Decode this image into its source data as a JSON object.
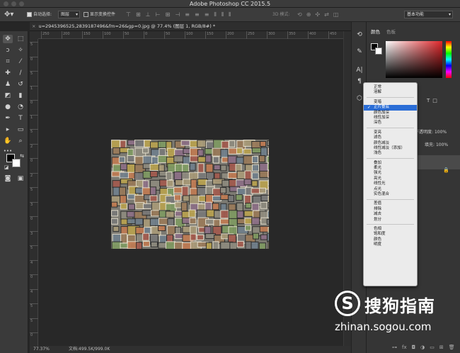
{
  "window": {
    "title": "Adobe Photoshop CC 2015.5"
  },
  "options_bar": {
    "auto_select_label": "自动选择:",
    "auto_select_value": "图层",
    "show_transform_label": "显示变换控件",
    "mode_3d_label": "3D 模式:",
    "workspace": "基本功能"
  },
  "document": {
    "tab_title": "u=2945396525,2839187496&fm=26&gp=0.jpg @ 77.4% (图层 1, RGB/8#) *"
  },
  "rulers": {
    "h_ticks": [
      "250",
      "200",
      "150",
      "100",
      "50",
      "0",
      "50",
      "100",
      "150",
      "200",
      "250",
      "300",
      "350",
      "400",
      "450"
    ],
    "v_ticks": [
      "5",
      "0",
      "5",
      "1",
      "0",
      "1",
      "5",
      "2",
      "0",
      "2",
      "5",
      "3",
      "0",
      "3",
      "5",
      "4",
      "0",
      "4",
      "5",
      "5",
      "0"
    ]
  },
  "status": {
    "zoom": "77.37%",
    "doc_info": "文档:499.5K/999.0K"
  },
  "panel": {
    "tab_color": "颜色",
    "tab_swatches": "色板",
    "opacity_label": "不透明度:",
    "opacity_value": "100%",
    "fill_label": "填充:",
    "fill_value": "100%"
  },
  "blend_menu": {
    "groups": [
      [
        "正常",
        "溶解"
      ],
      [
        "变暗",
        "正片叠底",
        "颜色加深",
        "线性加深",
        "深色"
      ],
      [
        "变亮",
        "滤色",
        "颜色减淡",
        "线性减淡（添加）",
        "浅色"
      ],
      [
        "叠加",
        "柔光",
        "强光",
        "亮光",
        "线性光",
        "点光",
        "实色混合"
      ],
      [
        "差值",
        "排除",
        "减去",
        "划分"
      ],
      [
        "色相",
        "饱和度",
        "颜色",
        "明度"
      ]
    ],
    "selected": "正片叠底"
  },
  "watermark": {
    "brand": "搜狗指南",
    "url": "zhinan.sogou.com",
    "logo_letter": "S"
  },
  "icons": {
    "move": "move-icon",
    "marquee": "marquee-icon",
    "lasso": "lasso-icon",
    "brush": "brush-icon",
    "text": "text-icon",
    "zoom": "zoom-icon"
  }
}
